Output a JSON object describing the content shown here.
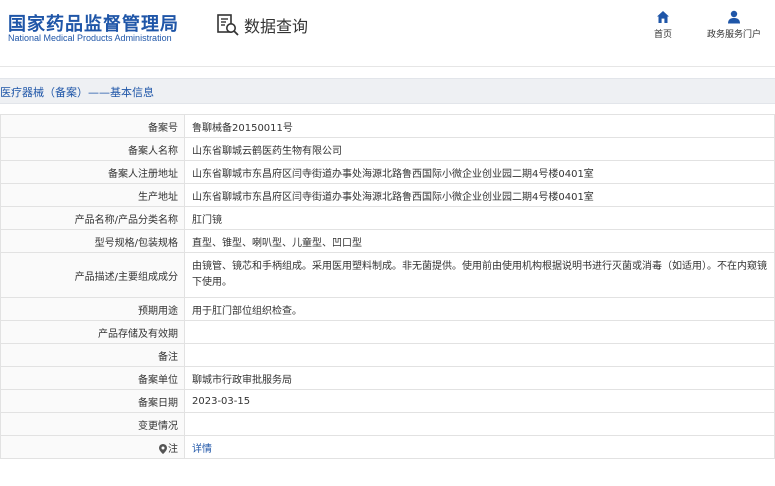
{
  "header": {
    "logo_cn": "国家药品监督管理局",
    "logo_en": "National Medical Products Administration",
    "search_title": "数据查询",
    "nav": {
      "home_label": "首页",
      "services_label": "政务服务门户"
    }
  },
  "section": {
    "title": "医疗器械（备案）——基本信息"
  },
  "rows": [
    {
      "label": "备案号",
      "value": "鲁聊械备20150011号"
    },
    {
      "label": "备案人名称",
      "value": "山东省聊城云鹤医药生物有限公司"
    },
    {
      "label": "备案人注册地址",
      "value": "山东省聊城市东昌府区闫寺街道办事处海源北路鲁西国际小微企业创业园二期4号楼0401室"
    },
    {
      "label": "生产地址",
      "value": "山东省聊城市东昌府区闫寺街道办事处海源北路鲁西国际小微企业创业园二期4号楼0401室"
    },
    {
      "label": "产品名称/产品分类名称",
      "value": "肛门镜"
    },
    {
      "label": "型号规格/包装规格",
      "value": "直型、锥型、喇叭型、儿童型、凹口型"
    },
    {
      "label": "产品描述/主要组成成分",
      "value": "由镜管、镜芯和手柄组成。采用医用塑料制成。非无菌提供。使用前由使用机构根据说明书进行灭菌或消毒（如适用）。不在内窥镜下使用。"
    },
    {
      "label": "预期用途",
      "value": "用于肛门部位组织检查。"
    },
    {
      "label": "产品存储及有效期",
      "value": ""
    },
    {
      "label": "备注",
      "value": ""
    },
    {
      "label": "备案单位",
      "value": "聊城市行政审批服务局"
    },
    {
      "label": "备案日期",
      "value": "2023-03-15"
    },
    {
      "label": "变更情况",
      "value": ""
    },
    {
      "label": "注",
      "value": "详情"
    }
  ],
  "colors": {
    "brand": "#1f56a8",
    "section_bg": "#eef0f3",
    "border": "#e2e2e2"
  }
}
